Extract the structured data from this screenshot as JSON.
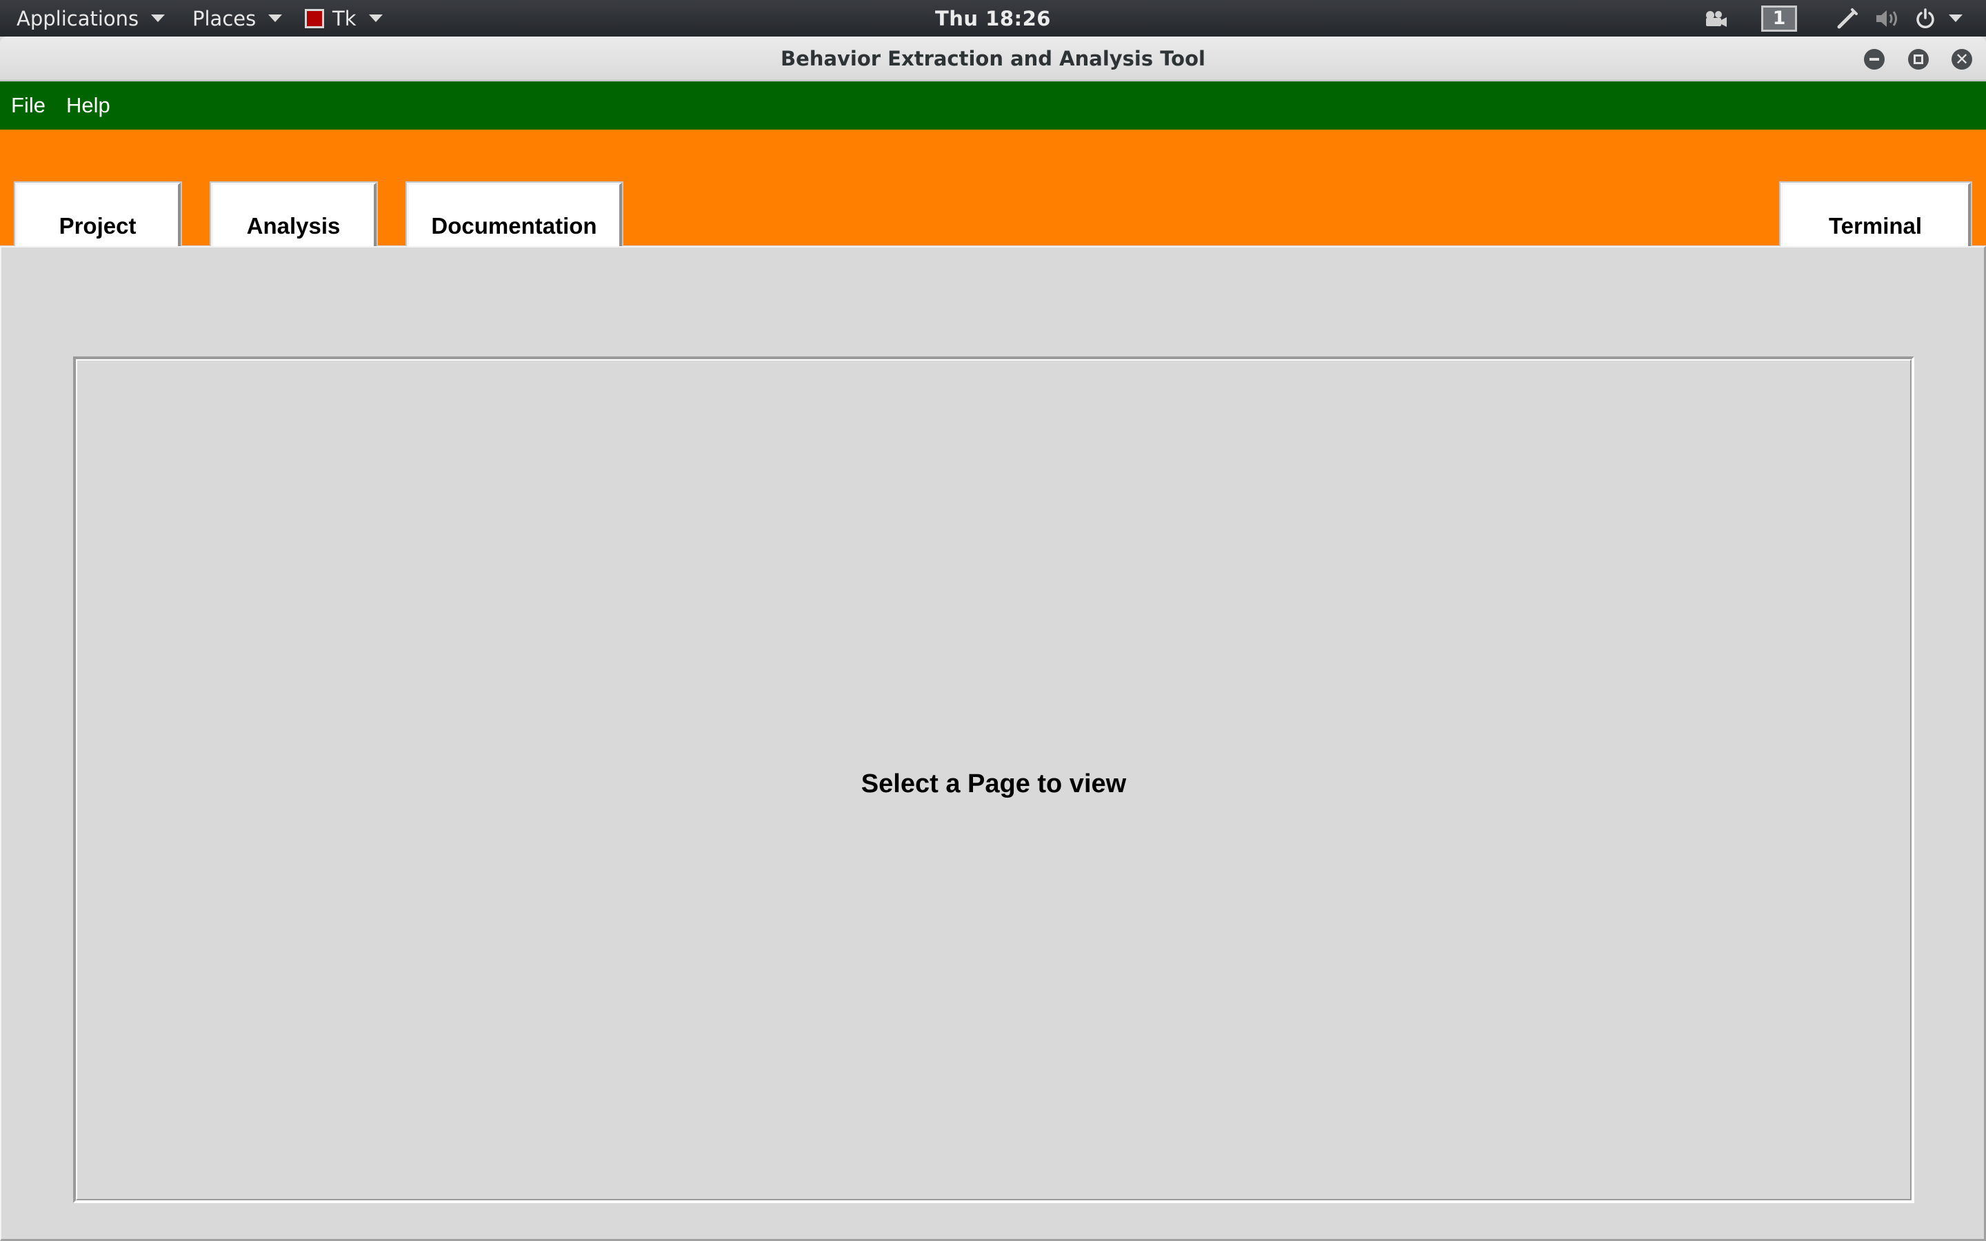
{
  "topbar": {
    "applications_label": "Applications",
    "places_label": "Places",
    "tk_label": "Tk",
    "clock": "Thu 18:26",
    "workspace_number": "1",
    "icons": [
      "camera-icon",
      "pen-icon",
      "volume-icon",
      "power-icon",
      "chevron-down-icon"
    ]
  },
  "window": {
    "title": "Behavior Extraction and Analysis Tool"
  },
  "menubar": {
    "items": [
      {
        "label": "File"
      },
      {
        "label": "Help"
      }
    ]
  },
  "toolbar": {
    "project_label": "Project",
    "analysis_label": "Analysis",
    "documentation_label": "Documentation",
    "terminal_label": "Terminal"
  },
  "main": {
    "placeholder_text": "Select a Page to view"
  },
  "colors": {
    "menubar_bg": "#006400",
    "toolbar_bg": "#ff8000",
    "content_bg": "#d9d9d9"
  }
}
